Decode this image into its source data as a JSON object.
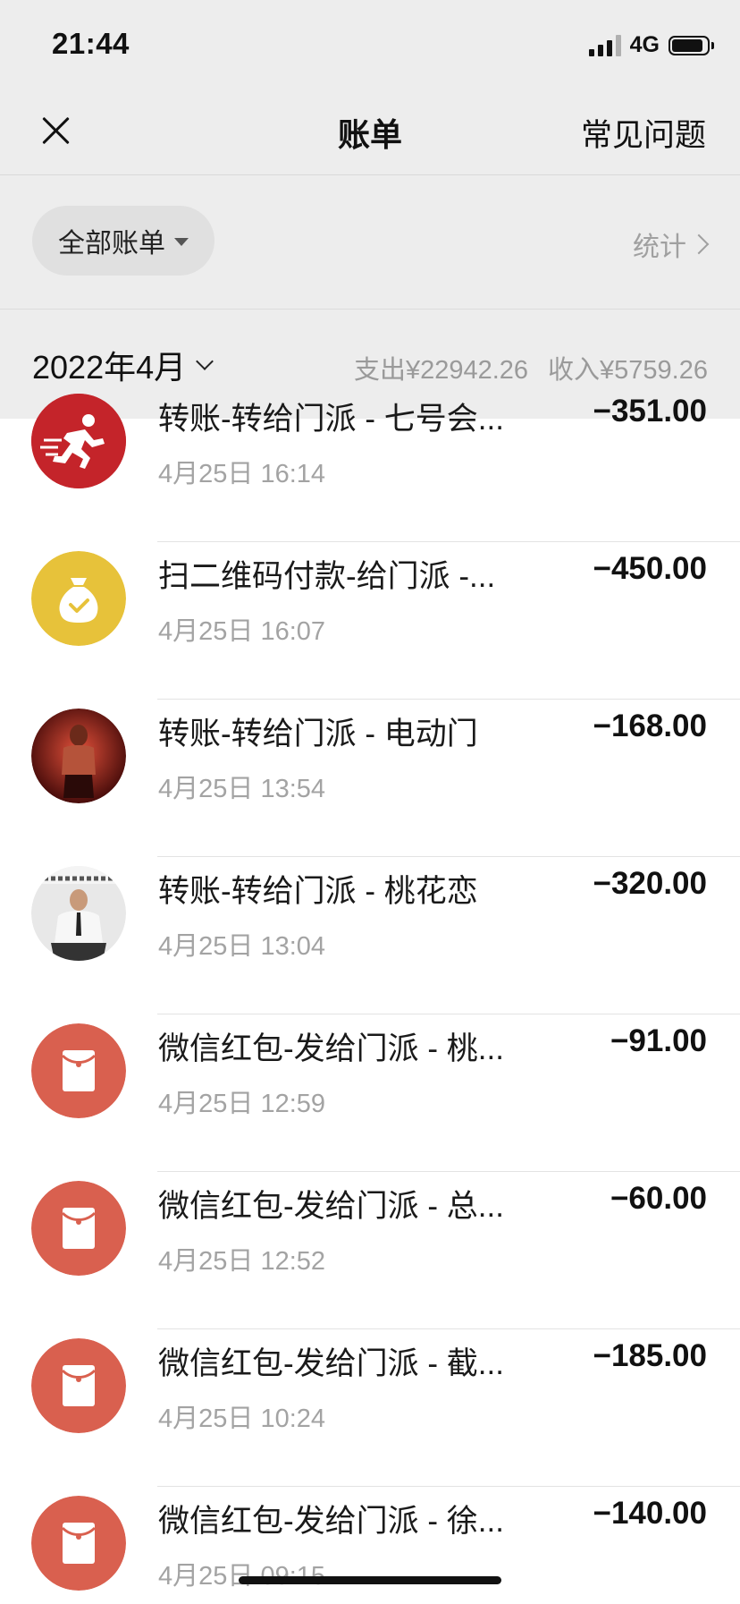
{
  "status_bar": {
    "time": "21:44",
    "network": "4G"
  },
  "nav": {
    "title": "账单",
    "faq_label": "常见问题"
  },
  "filter": {
    "label": "全部账单",
    "stats_label": "统计"
  },
  "month": {
    "label": "2022年4月",
    "expense": "支出¥22942.26",
    "income": "收入¥5759.26"
  },
  "colors": {
    "red_packet": "#d9604f",
    "pay_yellow": "#e7c23a",
    "runner_red": "#c4242a"
  },
  "transactions": [
    {
      "title": "转账-转给门派 - 七号会...",
      "time": "4月25日 16:14",
      "amount": "−351.00",
      "icon": "runner-logo-icon"
    },
    {
      "title": "扫二维码付款-给门派 -...",
      "time": "4月25日 16:07",
      "amount": "−450.00",
      "icon": "money-bag-icon"
    },
    {
      "title": "转账-转给门派 - 电动门",
      "time": "4月25日 13:54",
      "amount": "−168.00",
      "icon": "user-avatar"
    },
    {
      "title": "转账-转给门派 - 桃花恋",
      "time": "4月25日 13:04",
      "amount": "−320.00",
      "icon": "user-avatar"
    },
    {
      "title": "微信红包-发给门派 - 桃...",
      "time": "4月25日 12:59",
      "amount": "−91.00",
      "icon": "red-packet-icon"
    },
    {
      "title": "微信红包-发给门派 - 总...",
      "time": "4月25日 12:52",
      "amount": "−60.00",
      "icon": "red-packet-icon"
    },
    {
      "title": "微信红包-发给门派 - 截...",
      "time": "4月25日 10:24",
      "amount": "−185.00",
      "icon": "red-packet-icon"
    },
    {
      "title": "微信红包-发给门派 - 徐...",
      "time": "4月25日 09:15",
      "amount": "−140.00",
      "icon": "red-packet-icon"
    }
  ]
}
